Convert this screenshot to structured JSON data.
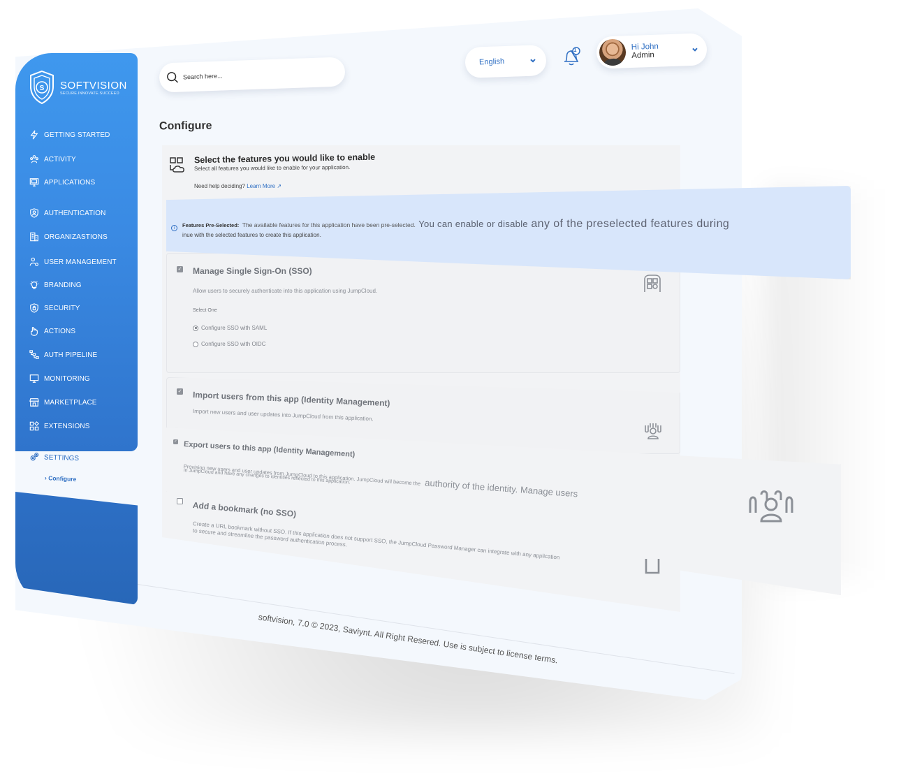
{
  "brand": {
    "name": "SOFTVISION",
    "tagline": "SECURE.INNOVATE.SUCCEED",
    "primary_color": "#3a8ae3",
    "dark_color": "#2867b8"
  },
  "sidebar": {
    "items": [
      {
        "label": "GETTING STARTED",
        "icon": "bolt-icon"
      },
      {
        "label": "ACTIVITY",
        "icon": "people-group-icon"
      },
      {
        "label": "APPLICATIONS",
        "icon": "monitor-app-icon"
      },
      {
        "label": "AUTHENTICATION",
        "icon": "user-shield-icon"
      },
      {
        "label": "ORGANIZASTIONS",
        "icon": "building-icon"
      },
      {
        "label": "USER MANAGEMENT",
        "icon": "user-gear-icon"
      },
      {
        "label": "BRANDING",
        "icon": "lightbulb-icon"
      },
      {
        "label": "SECURITY",
        "icon": "shield-lock-icon"
      },
      {
        "label": "ACTIONS",
        "icon": "hand-pointer-icon"
      },
      {
        "label": "AUTH PIPELINE",
        "icon": "pipeline-icon"
      },
      {
        "label": "MONITORING",
        "icon": "monitor-icon"
      },
      {
        "label": "MARKETPLACE",
        "icon": "store-icon"
      },
      {
        "label": "EXTENSIONS",
        "icon": "extensions-icon"
      }
    ],
    "settings": {
      "label": "SETTINGS",
      "icon": "gears-icon"
    },
    "settings_sub": {
      "label": "Configure",
      "icon": "chevron-right-icon"
    }
  },
  "header": {
    "search_placeholder": "Search here...",
    "language": "English",
    "notification_count": "1",
    "user_greeting": "Hi John",
    "user_role": "Admin"
  },
  "page": {
    "title": "Configure",
    "intro": {
      "title": "Select the features you would like to enable",
      "subtitle": "Select all features you would like to enable for your application.",
      "help_text": "Need help deciding?",
      "help_link": "Learn More ↗"
    },
    "banner": {
      "bold": "Features Pre-Selected:",
      "text_a": "The available features for this application have been pre-selected.",
      "text_b": "You can enable or disable",
      "text_c": "any of the preselected features during",
      "line2": "inue with the selected features to create this application."
    },
    "features": [
      {
        "title": "Manage Single Sign-On (SSO)",
        "description": "Allow users to securely authenticate into this application using JumpCloud.",
        "checked": true,
        "icon": "app-grid-icon",
        "select_label": "Select One",
        "options": [
          {
            "label": "Configure SSO with SAML",
            "selected": true
          },
          {
            "label": "Configure SSO with OIDC",
            "selected": false
          }
        ]
      },
      {
        "title": "Import users from this app (Identity Management)",
        "description": "Import new users and user updates into JumpCloud from this application.",
        "checked": true,
        "icon": "users-import-icon"
      },
      {
        "title": "Export users to this app (Identity Management)",
        "description_1": "Provision new users and user updates from JumpCloud to this application. JumpCloud will become the",
        "description_1b": "authority of the identity. Manage users",
        "description_2": "in JumpCloud and have any changes to identities reflected to this application.",
        "checked": true,
        "icon": "users-export-icon"
      },
      {
        "title": "Add a bookmark (no SSO)",
        "description_1": "Create a URL bookmark without SSO. If this application does not support SSO, the JumpCloud Password Manager can integrate with any application",
        "description_2": "to secure and streamline the password authentication process.",
        "checked": false,
        "icon": "bookmark-icon"
      }
    ]
  },
  "footer": {
    "text": "softvision, 7.0 © 2023, Saviynt. All Right Resered. Use is subject to license terms."
  }
}
